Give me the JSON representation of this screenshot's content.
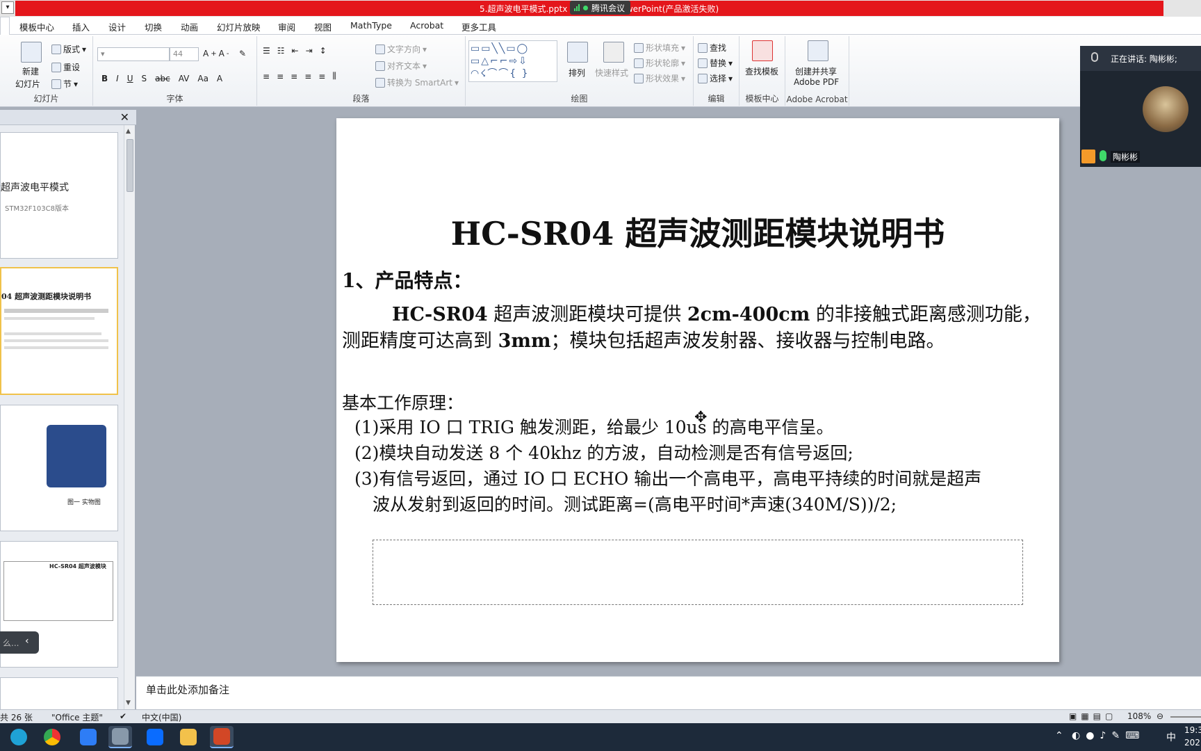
{
  "titlebar": {
    "title": "5.超声波电平模式.pptx - Microsoft PowerPoint(产品激活失败)",
    "meeting_label": "腾讯会议"
  },
  "tabs": [
    "模板中心",
    "插入",
    "设计",
    "切换",
    "动画",
    "幻灯片放映",
    "审阅",
    "视图",
    "MathType",
    "Acrobat",
    "更多工具"
  ],
  "ribbon": {
    "slides": {
      "new_slide": "新建",
      "new_slide2": "幻灯片",
      "layout": "版式",
      "reset": "重设",
      "section": "节",
      "label": "幻灯片"
    },
    "font": {
      "size": "44",
      "label": "字体"
    },
    "paragraph": {
      "text_dir": "文字方向",
      "align_text": "对齐文本",
      "smartart": "转换为 SmartArt",
      "label": "段落"
    },
    "drawing": {
      "arrange": "排列",
      "quick_styles": "快速样式",
      "shape_fill": "形状填充",
      "shape_outline": "形状轮廓",
      "shape_effects": "形状效果",
      "label": "绘图"
    },
    "editing": {
      "find": "查找",
      "replace": "替换",
      "select": "选择",
      "label": "编辑"
    },
    "template": {
      "find_template": "查找模板",
      "label": "模板中心"
    },
    "acrobat": {
      "create": "创建并共享",
      "create2": "Adobe PDF",
      "label": "Adobe Acrobat"
    }
  },
  "thumbnails": {
    "t1_title": "超声波电平模式",
    "t1_sub": "STM32F103C8版本",
    "t2_title": "04 超声波测距模块说明书",
    "t3_caption": "图一 实物图",
    "t4_header": "HC-SR04 超声波模块"
  },
  "slide": {
    "title": "HC-SR04 超声波测距模块说明书",
    "heading": "1、产品特点：",
    "para_b1": "HC-SR04",
    "para_t1": " 超声波测距模块可提供 ",
    "para_b2": "2cm-400cm",
    "para_t2": " 的非接触式距离感测功能，测距精度可达高到 ",
    "para_b3": "3mm",
    "para_t3": "；模块包括超声波发射器、接收器与控制电路。",
    "principle": "基本工作原理：",
    "items": [
      "(1)采用 IO 口 TRIG 触发测距，给最少 10us 的高电平信呈。",
      "(2)模块自动发送 8 个 40khz 的方波，自动检测是否有信号返回;",
      "(3)有信号返回，通过 IO 口 ECHO 输出一个高电平，高电平持续的时间就是超声",
      "波从发射到返回的时间。测试距离=(高电平时间*声速(340M/S))/2;"
    ]
  },
  "notes": {
    "placeholder": "单击此处添加备注"
  },
  "status": {
    "slides": "共 26 张",
    "theme": "\"Office 主题\"",
    "lang": "中文(中国)",
    "zoom": "108%"
  },
  "meeting": {
    "speaking": "正在讲话: 陶彬彬;",
    "user": "陶彬彬"
  },
  "tray": {
    "ime": "中",
    "time": "19:3",
    "date": "202"
  }
}
